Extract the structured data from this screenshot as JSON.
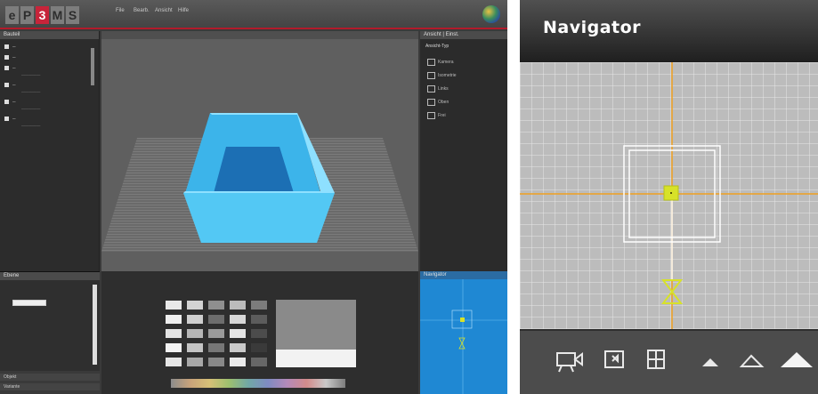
{
  "app": {
    "logo_letters": [
      "e",
      "P",
      "3",
      "M",
      "S"
    ],
    "menu": [
      "File",
      "Bearb.",
      "Ansicht",
      "Hilfe"
    ],
    "left_panel_title": "Bauteil",
    "layers_panel_title": "Ebene",
    "bottom_tabs": [
      "Objekt",
      "Variante"
    ],
    "right_panel_title": "Ansicht | Einst.",
    "right_section_label": "Ansicht-Typ",
    "right_options": [
      "Kamera",
      "Isometrie",
      "Links",
      "Oben",
      "Frei"
    ],
    "mini_nav_title": "Navigator",
    "colors": {
      "accent_red": "#c7243a",
      "box_cyan": "#53c8f4",
      "navigator_blue": "#1f88d3",
      "guide_orange": "#f0a020",
      "target_yellow": "#d7e228"
    }
  },
  "navigator": {
    "title": "Navigator",
    "toolbar_icons": [
      "camera-icon",
      "select-frame-icon",
      "grid-view-icon",
      "small-mountain-icon",
      "medium-mountain-icon",
      "large-mountain-icon"
    ]
  }
}
